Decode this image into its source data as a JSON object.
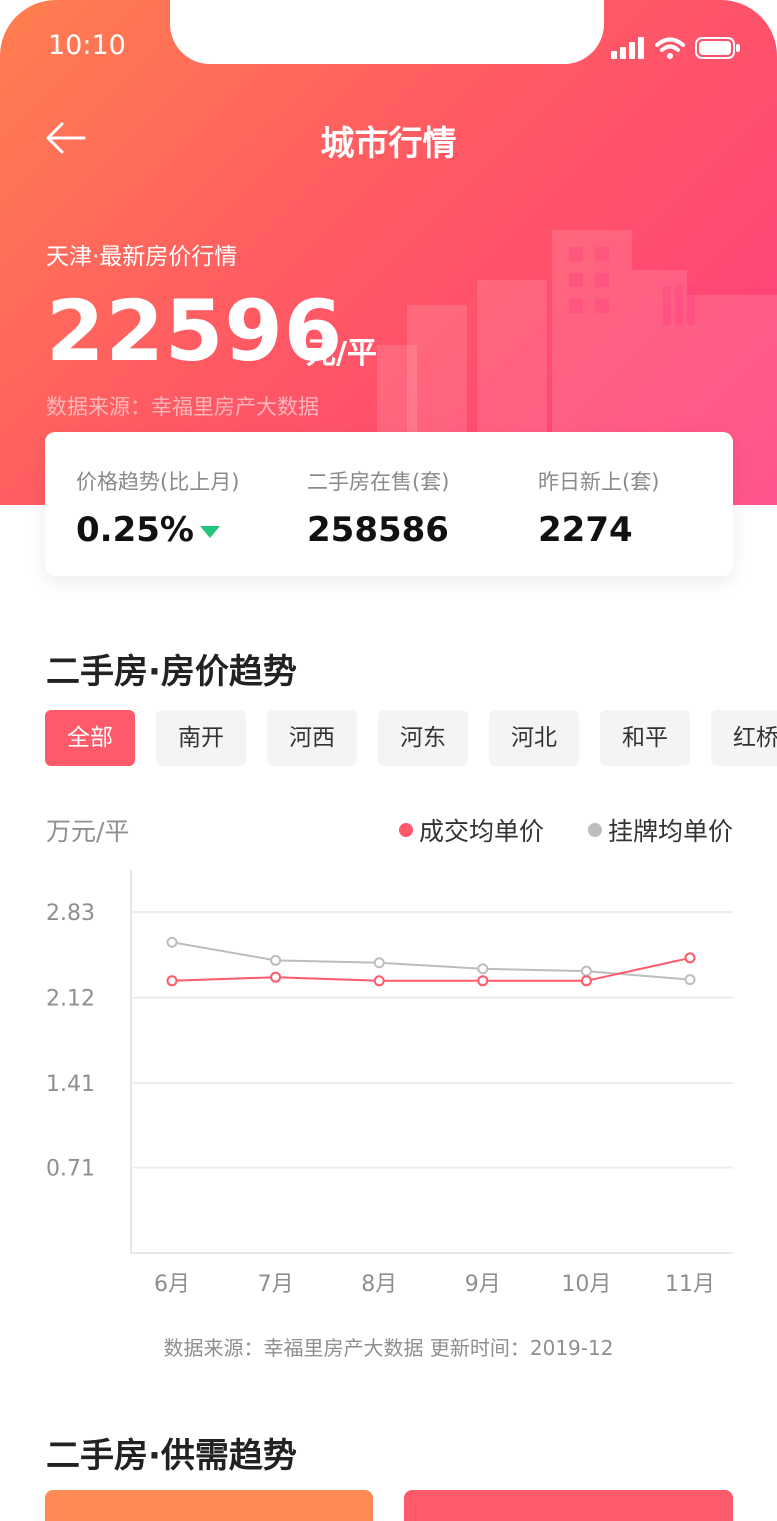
{
  "status": {
    "time": "10:10"
  },
  "nav": {
    "title": "城市行情"
  },
  "hero": {
    "city_label": "天津·最新房价行情",
    "price": "22596",
    "unit": "元/平",
    "source": "数据来源：幸福里房产大数据"
  },
  "stats": [
    {
      "label": "价格趋势(比上月)",
      "value": "0.25%",
      "trend": "down"
    },
    {
      "label": "二手房在售(套)",
      "value": "258586"
    },
    {
      "label": "昨日新上(套)",
      "value": "2274"
    }
  ],
  "section1": {
    "title": "二手房·房价趋势"
  },
  "tabs": [
    {
      "label": "全部",
      "active": true
    },
    {
      "label": "南开"
    },
    {
      "label": "河西"
    },
    {
      "label": "河东"
    },
    {
      "label": "河北"
    },
    {
      "label": "和平"
    },
    {
      "label": "红桥"
    }
  ],
  "chart_labels": {
    "unit": "万元/平"
  },
  "chart_data": {
    "type": "line",
    "ylabel": "万元/平",
    "categories": [
      "6月",
      "7月",
      "8月",
      "9月",
      "10月",
      "11月"
    ],
    "yticks": [
      "2.83",
      "2.12",
      "1.41",
      "0.71"
    ],
    "ylim": [
      0,
      3.18
    ],
    "series": [
      {
        "name": "成交均单价",
        "color": "#ff5a6b",
        "values": [
          2.26,
          2.29,
          2.26,
          2.26,
          2.26,
          2.45
        ]
      },
      {
        "name": "挂牌均单价",
        "color": "#bdbdbd",
        "values": [
          2.58,
          2.43,
          2.41,
          2.36,
          2.34,
          2.27
        ]
      }
    ],
    "legend": "top-right",
    "grid": true
  },
  "chart_source": "数据来源：幸福里房产大数据 更新时间：2019-12",
  "section2": {
    "title": "二手房·供需趋势"
  },
  "colors": {
    "accent": "#ff5a6b",
    "down": "#21c47a"
  }
}
